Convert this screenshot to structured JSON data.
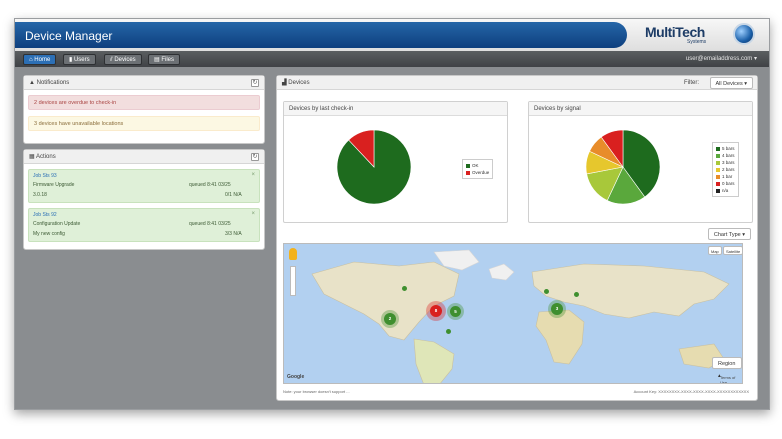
{
  "app": {
    "title": "Device Manager"
  },
  "logo": {
    "brand": "MultiTech",
    "sub": "Systems"
  },
  "nav": {
    "tabs": [
      {
        "label": "Home"
      },
      {
        "label": "Users"
      },
      {
        "label": "Devices"
      },
      {
        "label": "Files"
      }
    ],
    "user": "user@emailaddress.com ▾"
  },
  "notifications": {
    "title": "Notifications",
    "items": [
      {
        "text": "2 devices are overdue to check-in"
      },
      {
        "text": "3 devices have unavailable locations"
      }
    ]
  },
  "actions": {
    "title": "Actions",
    "items": [
      {
        "job": "Job Sts 93",
        "task": "Firmware Upgrade",
        "version": "3.0.18",
        "queued": "queued 8:41 03/25",
        "count": "0/1 N/A"
      },
      {
        "job": "Job Sts 92",
        "task": "Configuration Update",
        "version": "My new config",
        "queued": "queued 8:41 03/25",
        "count": "3/3 N/A"
      }
    ]
  },
  "devices": {
    "title": "Devices",
    "filter_label": "Filter:",
    "filter_value": "All Devices ▾",
    "checkin_title": "Devices by last check-in",
    "checkin_legend": [
      {
        "label": "OK",
        "color": "#1e6b1e"
      },
      {
        "label": "Overdue",
        "color": "#d9201f"
      }
    ],
    "signal_title": "Devices by signal",
    "signal_legend": [
      {
        "label": "5 bars",
        "color": "#1e6b1e"
      },
      {
        "label": "4 bars",
        "color": "#5aa83c"
      },
      {
        "label": "3 bars",
        "color": "#a8c83a"
      },
      {
        "label": "2 bars",
        "color": "#e6c72d"
      },
      {
        "label": "1 bar",
        "color": "#e88c2a"
      },
      {
        "label": "0 bars",
        "color": "#d9201f"
      },
      {
        "label": "n/a",
        "color": "#222222"
      }
    ],
    "chart_type": "Chart Type ▾",
    "map_buttons": {
      "map": "Map",
      "satellite": "Satellite"
    },
    "region": "Region ▴",
    "terms": "Terms of Use",
    "google": "Google",
    "map_note": "Note: your browser doesn't support ...",
    "account_key": "Account Key: XXXXXXXX-XXXX-XXXX-XXXX-XXXXXXXXXXXX",
    "clusters": [
      {
        "label": "2",
        "color": "#3f8f2f"
      },
      {
        "label": "8",
        "color": "#d9201f"
      },
      {
        "label": "5",
        "color": "#3f8f2f"
      },
      {
        "label": "3",
        "color": "#3f8f2f"
      }
    ]
  },
  "chart_data": [
    {
      "type": "pie",
      "title": "Devices by last check-in",
      "categories": [
        "OK",
        "Overdue"
      ],
      "values": [
        88,
        12
      ]
    },
    {
      "type": "pie",
      "title": "Devices by signal",
      "categories": [
        "5 bars",
        "4 bars",
        "3 bars",
        "2 bars",
        "1 bar",
        "0 bars",
        "n/a"
      ],
      "values": [
        40,
        17,
        15,
        10,
        8,
        10,
        0
      ]
    }
  ]
}
